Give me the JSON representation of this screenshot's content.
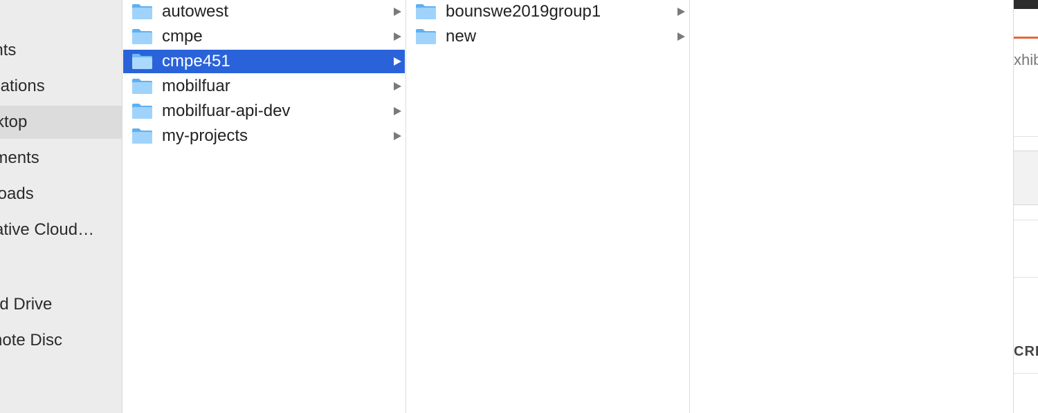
{
  "sidebar": {
    "items": [
      {
        "label": "ents",
        "selected": false
      },
      {
        "label": "lications",
        "selected": false
      },
      {
        "label": "ktop",
        "selected": true
      },
      {
        "label": "uments",
        "selected": false
      },
      {
        "label": "nloads",
        "selected": false
      },
      {
        "label": "ative Cloud…",
        "selected": false
      },
      {
        "label": "ud Drive",
        "selected": false
      },
      {
        "label": "note Disc",
        "selected": false
      }
    ]
  },
  "column1": {
    "items": [
      {
        "name": "autowest",
        "icon": "folder-icon",
        "selected": false
      },
      {
        "name": "cmpe",
        "icon": "folder-icon",
        "selected": false
      },
      {
        "name": "cmpe451",
        "icon": "folder-icon",
        "selected": true
      },
      {
        "name": "mobilfuar",
        "icon": "folder-icon",
        "selected": false
      },
      {
        "name": "mobilfuar-api-dev",
        "icon": "folder-icon",
        "selected": false
      },
      {
        "name": "my-projects",
        "icon": "folder-icon",
        "selected": false
      }
    ]
  },
  "column2": {
    "items": [
      {
        "name": "bounswe2019group1",
        "icon": "folder-icon",
        "selected": false
      },
      {
        "name": "new",
        "icon": "folder-icon",
        "selected": false
      }
    ]
  },
  "background_window": {
    "text1": "xhib",
    "text2": "CRI"
  },
  "colors": {
    "selection": "#2a63d9",
    "folder_light": "#9fd3fb",
    "folder_dark": "#5fb0f2",
    "accent_orange": "#e8653a"
  }
}
